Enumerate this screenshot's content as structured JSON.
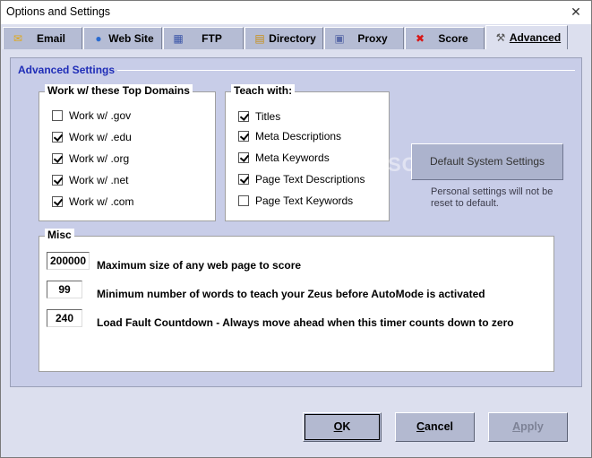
{
  "window": {
    "title": "Options and Settings",
    "close_glyph": "✕"
  },
  "tabs": [
    {
      "label": "Email",
      "icon": "envelope-icon",
      "glyph": "✉",
      "color": "#e0a818"
    },
    {
      "label": "Web Site",
      "icon": "globe-icon",
      "glyph": "●",
      "color": "#2a6bd0"
    },
    {
      "label": "FTP",
      "icon": "network-icon",
      "glyph": "▦",
      "color": "#3a55a8"
    },
    {
      "label": "Directory",
      "icon": "folder-tree-icon",
      "glyph": "▤",
      "color": "#c89018"
    },
    {
      "label": "Proxy",
      "icon": "server-icon",
      "glyph": "▣",
      "color": "#5a6aa8"
    },
    {
      "label": "Score",
      "icon": "red-x-icon",
      "glyph": "✖",
      "color": "#d81818"
    },
    {
      "label": "Advanced",
      "icon": "tools-icon",
      "glyph": "⚒",
      "color": "#555555",
      "active": true
    }
  ],
  "advanced": {
    "heading": "Advanced Settings",
    "domains": {
      "legend": "Work w/ these Top Domains",
      "items": [
        {
          "label": "Work w/ .gov",
          "checked": false
        },
        {
          "label": "Work w/ .edu",
          "checked": true
        },
        {
          "label": "Work w/ .org",
          "checked": true
        },
        {
          "label": "Work w/ .net",
          "checked": true
        },
        {
          "label": "Work w/ .com",
          "checked": true
        }
      ]
    },
    "teach": {
      "legend": "Teach with:",
      "items": [
        {
          "label": "Titles",
          "checked": true
        },
        {
          "label": "Meta Descriptions",
          "checked": true
        },
        {
          "label": "Meta Keywords",
          "checked": true
        },
        {
          "label": "Page Text Descriptions",
          "checked": true
        },
        {
          "label": "Page Text Keywords",
          "checked": false
        }
      ]
    },
    "default_button": "Default System Settings",
    "default_note": "Personal settings will not be reset to default.",
    "watermark": "SOFTPEDIA",
    "misc": {
      "legend": "Misc",
      "rows": [
        {
          "value": "200000",
          "label": "Maximum size of any web page to score"
        },
        {
          "value": "99",
          "label": "Minimum number of words to teach your Zeus before AutoMode is activated"
        },
        {
          "value": "240",
          "label": "Load Fault Countdown - Always move ahead when this timer counts down to zero"
        }
      ]
    }
  },
  "footer": {
    "ok": {
      "mnemonic": "O",
      "rest": "K"
    },
    "cancel": {
      "mnemonic": "C",
      "rest": "ancel"
    },
    "apply": {
      "mnemonic": "A",
      "rest": "pply"
    }
  }
}
